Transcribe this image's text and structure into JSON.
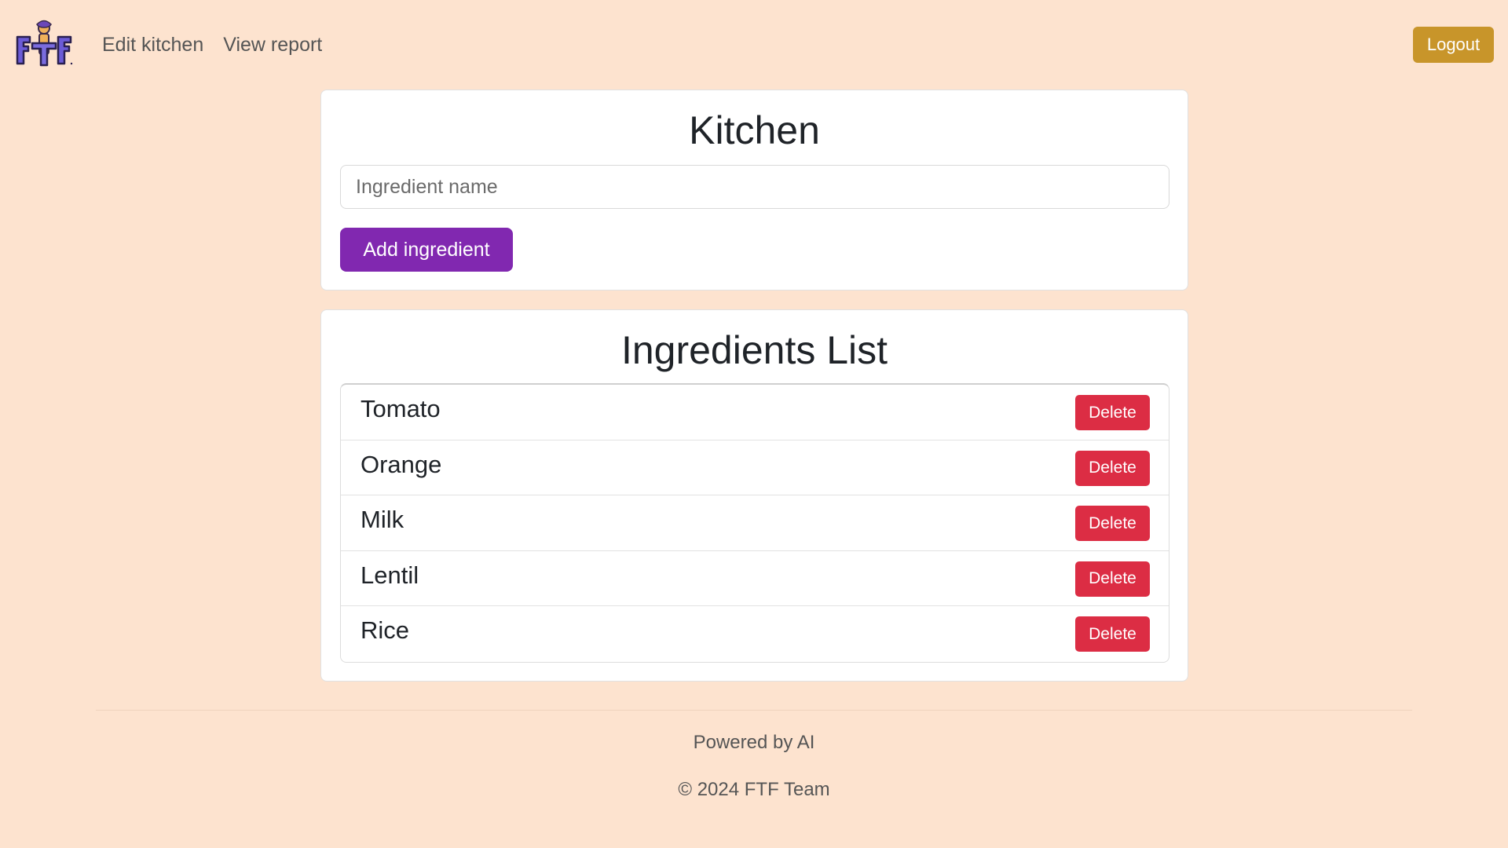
{
  "navbar": {
    "logo_icon": "ftf-logo-icon",
    "logo_text": "FTF",
    "links": [
      {
        "label": "Edit kitchen"
      },
      {
        "label": "View report"
      }
    ],
    "logout_label": "Logout",
    "logout_color": "#c8952a"
  },
  "kitchen": {
    "title": "Kitchen",
    "input": {
      "placeholder": "Ingredient name",
      "value": ""
    },
    "add_button_label": "Add ingredient",
    "add_button_color": "#8128b0"
  },
  "ingredients": {
    "title": "Ingredients List",
    "items": [
      {
        "name": "Tomato",
        "delete_label": "Delete"
      },
      {
        "name": "Orange",
        "delete_label": "Delete"
      },
      {
        "name": "Milk",
        "delete_label": "Delete"
      },
      {
        "name": "Lentil",
        "delete_label": "Delete"
      },
      {
        "name": "Rice",
        "delete_label": "Delete"
      }
    ],
    "delete_color": "#dc2d44"
  },
  "footer": {
    "powered": "Powered by AI",
    "copyright": "© 2024 FTF Team"
  },
  "colors": {
    "background": "#fde3cf",
    "card": "#ffffff"
  }
}
